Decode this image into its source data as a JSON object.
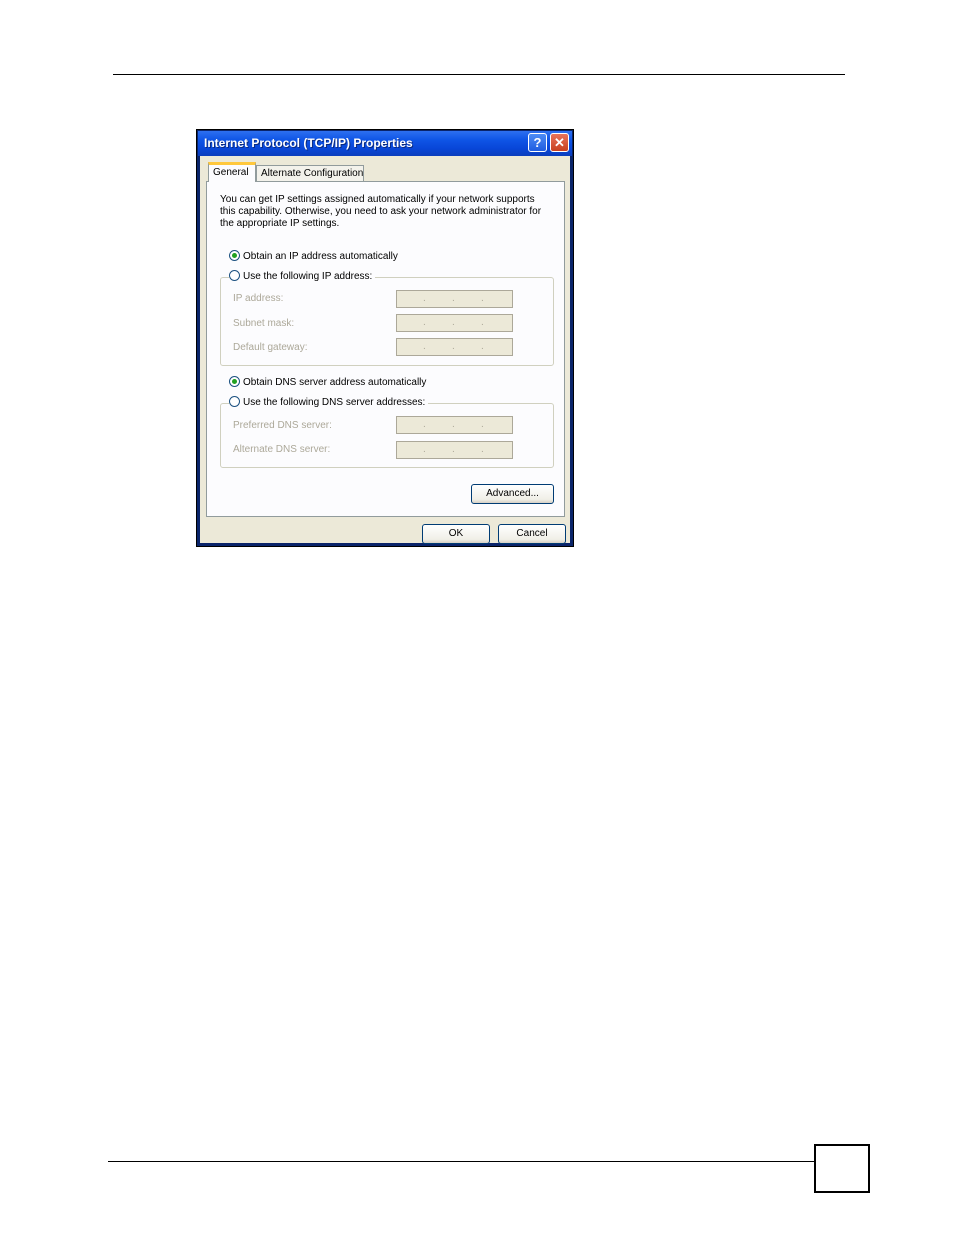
{
  "dialog": {
    "title": "Internet Protocol (TCP/IP) Properties",
    "help_glyph": "?",
    "close_glyph": "✕",
    "tabs": [
      {
        "label": "General",
        "selected": true
      },
      {
        "label": "Alternate Configuration",
        "selected": false
      }
    ],
    "intro": "You can get IP settings assigned automatically if your network supports this capability. Otherwise, you need to ask your network administrator for the appropriate IP settings.",
    "ip": {
      "auto_label": "Obtain an IP address automatically",
      "manual_label": "Use the following IP address:",
      "selected": "auto",
      "fields": [
        {
          "label": "IP address:",
          "value": ". . ."
        },
        {
          "label": "Subnet mask:",
          "value": ". . ."
        },
        {
          "label": "Default gateway:",
          "value": ". . ."
        }
      ]
    },
    "dns": {
      "auto_label": "Obtain DNS server address automatically",
      "manual_label": "Use the following DNS server addresses:",
      "selected": "auto",
      "fields": [
        {
          "label": "Preferred DNS server:",
          "value": ". . ."
        },
        {
          "label": "Alternate DNS server:",
          "value": ". . ."
        }
      ]
    },
    "advanced_label": "Advanced...",
    "ok_label": "OK",
    "cancel_label": "Cancel"
  }
}
